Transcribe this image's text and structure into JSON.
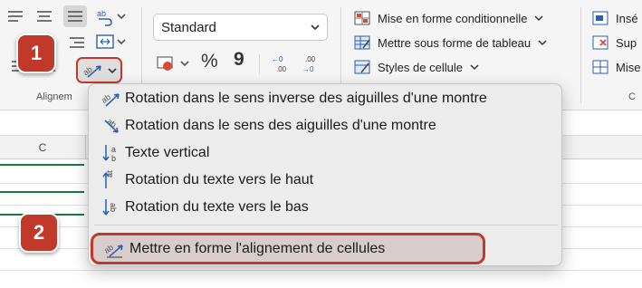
{
  "ribbon": {
    "alignment_group_label": "Alignem",
    "number_format": {
      "selected": "Standard"
    },
    "number_buttons": {
      "percent": "%",
      "comma": "9",
      "increase_decimal": "←0 .00",
      "decrease_decimal": ".00 →0"
    },
    "styles": [
      {
        "label": "Mise en forme conditionnelle",
        "icon": "conditional-format-icon"
      },
      {
        "label": "Mettre sous forme de tableau",
        "icon": "format-table-icon"
      },
      {
        "label": "Styles de cellule",
        "icon": "cell-styles-icon"
      }
    ],
    "cells": [
      {
        "label": "Insé",
        "icon": "insert-cells-icon"
      },
      {
        "label": "Sup",
        "icon": "delete-cells-icon"
      },
      {
        "label": "Mise",
        "icon": "format-cells-icon"
      }
    ],
    "cells_group_label": "C"
  },
  "sheet": {
    "column_c": "C"
  },
  "menu": {
    "items": [
      {
        "label": "Rotation dans le sens inverse des aiguilles d'une montre",
        "icon": "rotate-ccw-icon"
      },
      {
        "label": "Rotation dans le sens des aiguilles d'une montre",
        "icon": "rotate-cw-icon"
      },
      {
        "label": "Texte vertical",
        "icon": "vertical-text-icon"
      },
      {
        "label": "Rotation du texte vers le haut",
        "icon": "rotate-up-icon"
      },
      {
        "label": "Rotation du texte vers le bas",
        "icon": "rotate-down-icon"
      }
    ],
    "format_alignment": {
      "label": "Mettre en forme l'alignement de cellules",
      "icon": "format-alignment-icon"
    }
  },
  "steps": {
    "one": "1",
    "two": "2"
  },
  "colors": {
    "accent_red": "#c0392b",
    "excel_green": "#1e7a3c"
  }
}
